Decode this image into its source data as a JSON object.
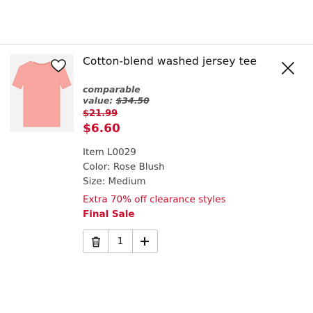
{
  "cart_item": {
    "title": "Cotton-blend washed jersey tee",
    "comparable_label": "comparable",
    "comparable_prefix": "value:",
    "comparable_value": "$34.50",
    "original_price": "$21.99",
    "sale_price": "$6.60",
    "item_number": "Item L0029",
    "color": "Color: Rose Blush",
    "size": "Size: Medium",
    "promo_message": "Extra 70% off clearance styles",
    "final_sale": "Final Sale",
    "quantity": "1"
  },
  "icons": {
    "favorite": "heart-outline-icon",
    "remove": "close-icon",
    "delete": "trash-icon",
    "increase": "plus-icon"
  },
  "colors": {
    "sale_red": "#c8102e",
    "product_pink": "#f8a7a0"
  }
}
